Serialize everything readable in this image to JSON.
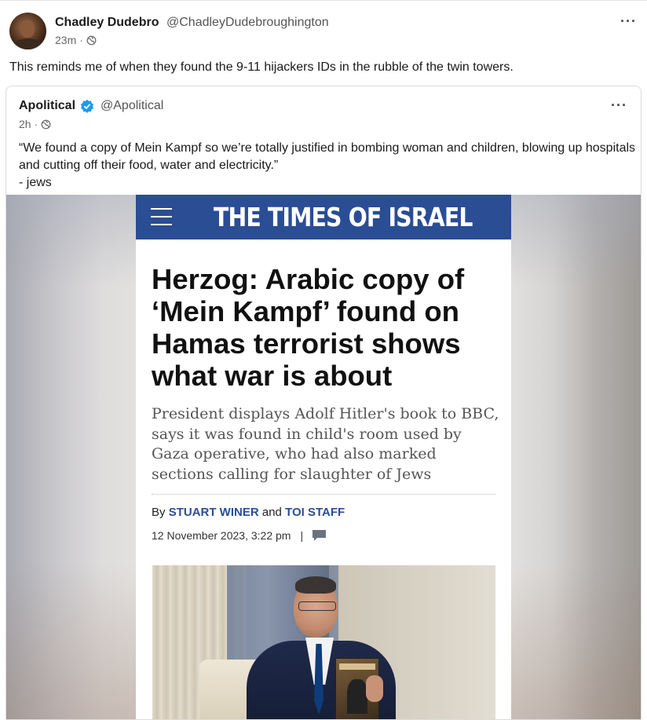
{
  "post": {
    "author_name": "Chadley Dudebro",
    "author_handle": "@ChadleyDudebroughington",
    "time": "23m",
    "separator": "·",
    "visibility_icon": "globe-icon",
    "more_icon": "···",
    "text": "This reminds me of when they found the 9-11 hijackers IDs in the rubble of the twin towers."
  },
  "quote": {
    "author_name": "Apolitical",
    "author_handle": "@Apolitical",
    "verified_icon": "verified-badge-icon",
    "time": "2h",
    "separator": "·",
    "more_icon": "···",
    "text_line1": "“We found a copy of Mein Kampf so we’re totally justified in bombing woman and children, blowing up hospitals and cutting off their food, water and electricity.”",
    "text_line2": "- jews"
  },
  "article": {
    "masthead": "THE TIMES OF ISRAEL",
    "headline": "Herzog: Arabic copy of ‘Mein Kampf’ found on Hamas terrorist shows what war is about",
    "subhead": "President displays Adolf Hitler's book to BBC, says it was found in child's room used by Gaza operative, who had also marked sections calling for slaughter of Jews",
    "byline_prefix": "By",
    "author1": "STUART WINER",
    "byline_and": "and",
    "author2": "TOI STAFF",
    "date": "12 November 2023, 3:22 pm",
    "date_sep": "|"
  },
  "colors": {
    "masthead_bg": "#2a4d94",
    "verified": "#1d9bf0",
    "byline_author": "#2a4d94"
  }
}
